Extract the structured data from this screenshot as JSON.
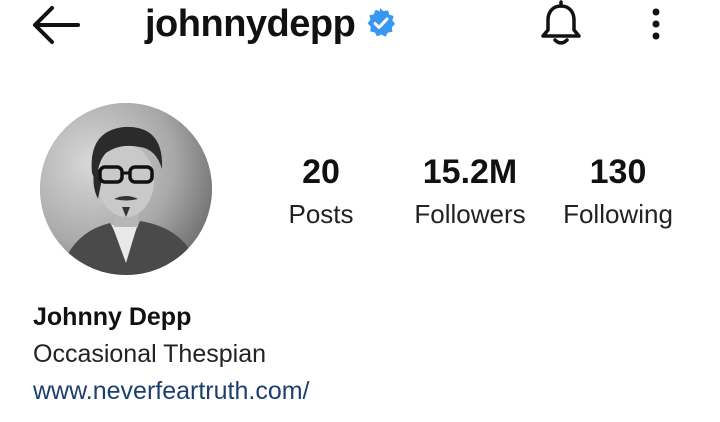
{
  "header": {
    "username": "johnnydepp",
    "back_icon": "arrow-left-icon",
    "verified_icon": "verified-badge-icon",
    "notification_icon": "bell-icon",
    "menu_icon": "more-vertical-icon",
    "verified_color": "#3897f0"
  },
  "profile": {
    "avatar": "profile-photo",
    "display_name": "Johnny Depp",
    "bio": "Occasional Thespian",
    "website": "www.neverfeartruth.com/"
  },
  "stats": [
    {
      "count": "20",
      "label": "Posts"
    },
    {
      "count": "15.2M",
      "label": "Followers"
    },
    {
      "count": "130",
      "label": "Following"
    }
  ],
  "colors": {
    "link": "#1c3f6e",
    "text": "#262626"
  }
}
